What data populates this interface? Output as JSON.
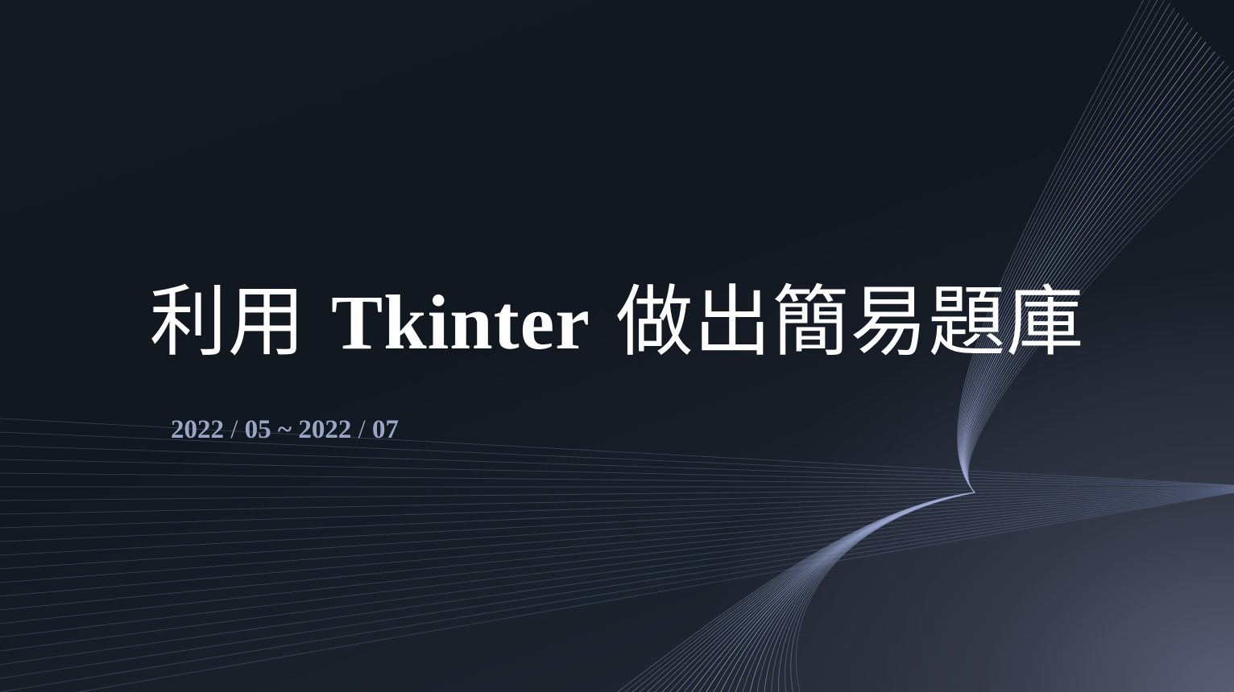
{
  "slide": {
    "title": {
      "prefix": "利用",
      "latin": "Tkinter",
      "suffix": "做出簡易題庫"
    },
    "date": {
      "start_year": "2022",
      "slash": "/",
      "start_month": "05",
      "tilde": "~",
      "end_year": "2022",
      "end_month": "07"
    }
  },
  "colors": {
    "title_text": "#ffffff",
    "date_text": "#9aa6c6",
    "line_primary": "#8a9bd0",
    "line_secondary": "#b8c0dc",
    "background": "#11171f"
  }
}
